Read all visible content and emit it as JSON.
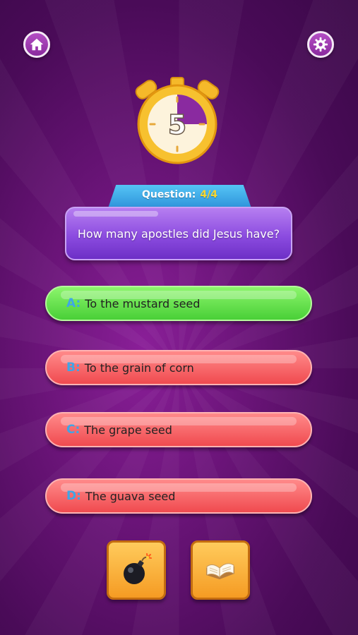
{
  "timer": {
    "seconds": "5"
  },
  "question": {
    "label": "Question:",
    "progress": "4/4",
    "text": "How many apostles did Jesus have?"
  },
  "answers": [
    {
      "letter": "A:",
      "text": "To the mustard seed",
      "state": "correct"
    },
    {
      "letter": "B:",
      "text": "To the grain of corn",
      "state": "wrong"
    },
    {
      "letter": "C:",
      "text": "The grape seed",
      "state": "wrong"
    },
    {
      "letter": "D:",
      "text": "The guava seed",
      "state": "wrong"
    }
  ],
  "colors": {
    "correct": "#49cf37",
    "wrong": "#f04a4f",
    "letter": "#3fa6e6",
    "progress": "#f7d631"
  },
  "icons": {
    "home": "home-icon",
    "settings": "gear-icon",
    "bomb": "bomb-icon",
    "book": "book-icon"
  }
}
